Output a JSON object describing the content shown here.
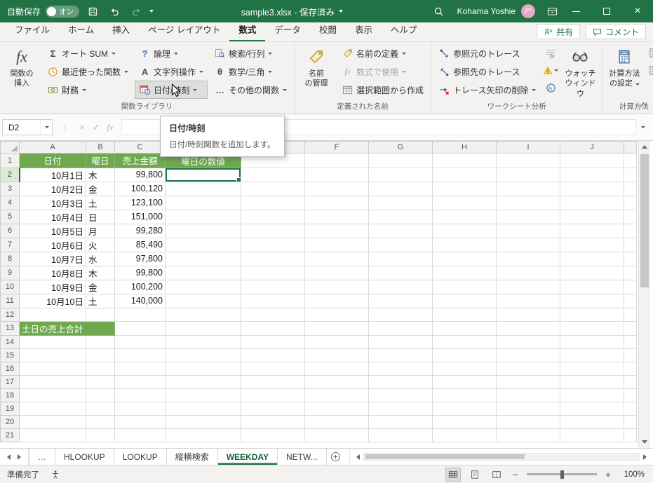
{
  "colors": {
    "titlebar_green": "#217346",
    "accent_green": "#217346",
    "header_fill_green": "#6FA84F",
    "selection_border": "#217346",
    "ribbon_background": "#f3f2f1",
    "disabled_text": "#a8a8a8"
  },
  "icons": {
    "sigma": "Σ",
    "theta": "θ",
    "question": "?",
    "letterA": "A",
    "ellipsis": "…",
    "fx": "fx",
    "cancel": "×",
    "confirm": "✓",
    "dots": "⋮",
    "minus": "−",
    "plus": "+",
    "close": "×"
  },
  "titlebar": {
    "autosave_label": "自動保存",
    "autosave_state": "オン",
    "title": "sample3.xlsx - 保存済み",
    "user": "Kohama Yoshie"
  },
  "ribbon": {
    "tabs": [
      "ファイル",
      "ホーム",
      "挿入",
      "ページ レイアウト",
      "数式",
      "データ",
      "校閲",
      "表示",
      "ヘルプ"
    ],
    "active_tab": "数式",
    "share": "共有",
    "comments": "コメント",
    "function_library": {
      "label": "関数ライブラリ",
      "insert_function_l1": "関数の",
      "insert_function_l2": "挿入",
      "autosum": "オート SUM",
      "recent": "最近使った関数",
      "financial": "財務",
      "logical": "論理",
      "text": "文字列操作",
      "datetime": "日付/時刻",
      "lookup": "検索/行列",
      "math": "数学/三角",
      "more": "その他の関数"
    },
    "defined_names": {
      "label": "定義された名前",
      "name_manager_l1": "名前",
      "name_manager_l2": "の管理",
      "define_name": "名前の定義",
      "use_in_formula": "数式で使用",
      "create_from_selection": "選択範囲から作成"
    },
    "auditing": {
      "label": "ワークシート分析",
      "trace_precedents": "参照元のトレース",
      "trace_dependents": "参照先のトレース",
      "remove_arrows": "トレース矢印の削除",
      "watch_l1": "ウォッチ",
      "watch_l2": "ウィンドウ"
    },
    "calculation": {
      "label": "計算方法",
      "calc_options_l1": "計算方法",
      "calc_options_l2": "の設定"
    }
  },
  "tooltip": {
    "title": "日付/時刻",
    "body": "日付/時刻関数を追加します。"
  },
  "formula_bar": {
    "name_box": "D2",
    "formula": ""
  },
  "grid": {
    "columns": [
      "A",
      "B",
      "C",
      "D",
      "E",
      "F",
      "G",
      "H",
      "I",
      "J"
    ],
    "visible_rows": 21,
    "selected": {
      "ref": "D2",
      "col": "D",
      "row": 2
    },
    "rows": [
      {
        "n": 1,
        "type": "header",
        "cells": {
          "A": "日付",
          "B": "曜日",
          "C": "売上金額",
          "D": "曜日の数値"
        }
      },
      {
        "n": 2,
        "cells": {
          "A": "10月1日",
          "B": "木",
          "C": "99,800"
        }
      },
      {
        "n": 3,
        "cells": {
          "A": "10月2日",
          "B": "金",
          "C": "100,120"
        }
      },
      {
        "n": 4,
        "cells": {
          "A": "10月3日",
          "B": "土",
          "C": "123,100"
        }
      },
      {
        "n": 5,
        "cells": {
          "A": "10月4日",
          "B": "日",
          "C": "151,000"
        }
      },
      {
        "n": 6,
        "cells": {
          "A": "10月5日",
          "B": "月",
          "C": "99,280"
        }
      },
      {
        "n": 7,
        "cells": {
          "A": "10月6日",
          "B": "火",
          "C": "85,490"
        }
      },
      {
        "n": 8,
        "cells": {
          "A": "10月7日",
          "B": "水",
          "C": "97,800"
        }
      },
      {
        "n": 9,
        "cells": {
          "A": "10月8日",
          "B": "木",
          "C": "99,800"
        }
      },
      {
        "n": 10,
        "cells": {
          "A": "10月9日",
          "B": "金",
          "C": "100,200"
        }
      },
      {
        "n": 11,
        "cells": {
          "A": "10月10日",
          "B": "土",
          "C": "140,000"
        }
      },
      {
        "n": 13,
        "type": "label",
        "cells": {
          "A": "土日の売上合計"
        }
      }
    ]
  },
  "sheet_tabs": {
    "overflow": "…",
    "tabs": [
      {
        "label": "HLOOKUP",
        "active": false
      },
      {
        "label": "LOOKUP",
        "active": false
      },
      {
        "label": "縦横検索",
        "active": false
      },
      {
        "label": "WEEKDAY",
        "active": true
      },
      {
        "label": "NETW...",
        "active": false
      }
    ]
  },
  "status_bar": {
    "ready": "準備完了",
    "zoom": "100%"
  }
}
